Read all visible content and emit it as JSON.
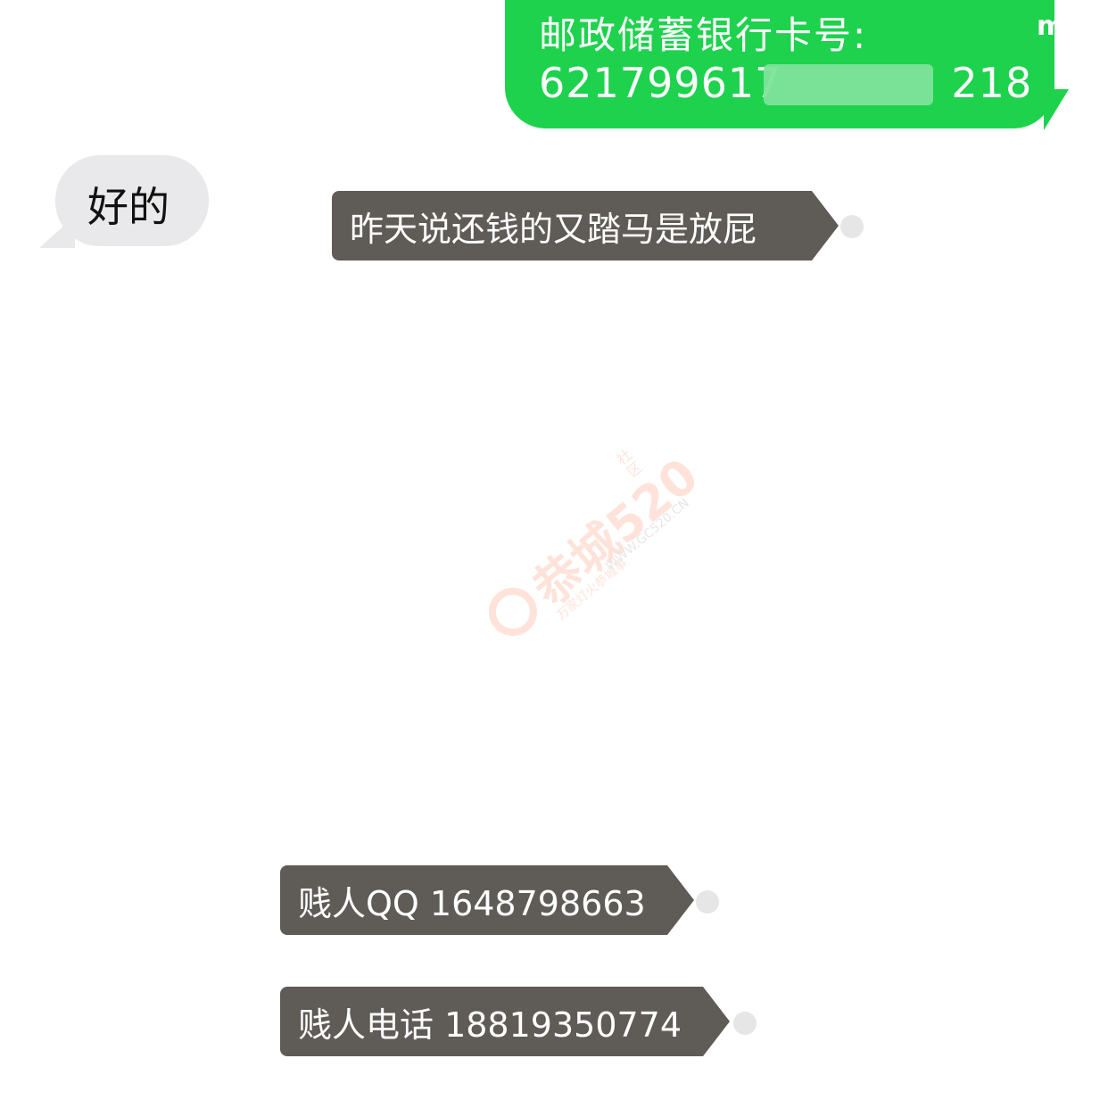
{
  "outgoing_green": {
    "line1": "邮政储蓄银行卡号:",
    "line2": "621799617",
    "line2_tail": "218",
    "clip_char": "m"
  },
  "incoming_gray": {
    "text": "好的"
  },
  "forwarded_messages": [
    {
      "text": "昨天说还钱的又踏马是放屁"
    },
    {
      "text": "贱人QQ 1648798663"
    },
    {
      "text": "贱人电话 18819350774"
    }
  ],
  "watermark": {
    "brand": "恭城520",
    "sub": "万家灯火恭城事",
    "url": "WWW.GC520.CN",
    "side": "社区",
    "color": "#ff6a3a"
  },
  "colors": {
    "green_bubble": "#1ed24e",
    "gray_bubble": "#e9e9eb",
    "dark_message": "#5f5b57",
    "background": "#ffffff"
  }
}
